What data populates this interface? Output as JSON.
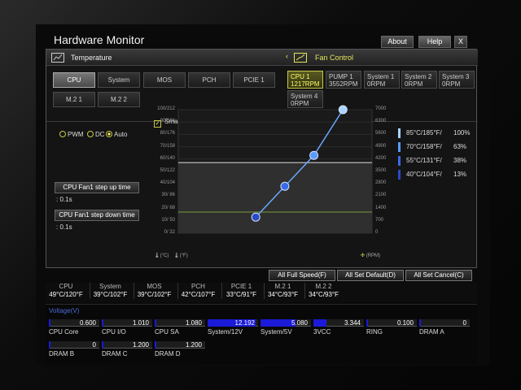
{
  "header": {
    "title": "Hardware Monitor",
    "about_label": "About",
    "help_label": "Help",
    "close_label": "X"
  },
  "temperature": {
    "title": "Temperature",
    "sensors": [
      "CPU",
      "System",
      "MOS",
      "PCH",
      "PCIE 1",
      "M.2 1",
      "M.2 2"
    ],
    "selected": "CPU"
  },
  "fan_control": {
    "title": "Fan Control",
    "fans": [
      {
        "name": "CPU 1",
        "rpm": "1217RPM"
      },
      {
        "name": "PUMP 1",
        "rpm": "3552RPM"
      },
      {
        "name": "System 1",
        "rpm": "0RPM"
      },
      {
        "name": "System 2",
        "rpm": "0RPM"
      },
      {
        "name": "System 3",
        "rpm": "0RPM"
      },
      {
        "name": "System 4",
        "rpm": "0RPM"
      }
    ]
  },
  "mode": {
    "pwm": "PWM",
    "dc": "DC",
    "auto": "Auto",
    "selected": "Auto"
  },
  "step_up": {
    "label": "CPU Fan1 step up time",
    "value": ": 0.1s"
  },
  "step_down": {
    "label": "CPU Fan1 step down time",
    "value": ": 0.1s"
  },
  "smart_fan": {
    "label": "Smart Fan Mode",
    "checked": true
  },
  "chart_data": {
    "type": "line",
    "title": "",
    "left_axis_ticks": [
      "100/212",
      "90/194",
      "80/176",
      "70/158",
      "60/140",
      "50/122",
      "40/104",
      "30/ 86",
      "20/ 68",
      "10/ 50",
      "0/ 32"
    ],
    "right_axis_ticks": [
      "7000",
      "6300",
      "5600",
      "4900",
      "4200",
      "3500",
      "2800",
      "2100",
      "1400",
      "700",
      "0"
    ],
    "xlabel_c": "(°C)",
    "xlabel_f": "(°F)",
    "ylabel": "(RPM)",
    "xlim": [
      0,
      100
    ],
    "ylim": [
      0,
      7000
    ],
    "curve": {
      "name": "Smart Fan Curve",
      "points": [
        {
          "temp": 40,
          "pct": 13
        },
        {
          "temp": 55,
          "pct": 38
        },
        {
          "temp": 70,
          "pct": 63
        },
        {
          "temp": 85,
          "pct": 100
        }
      ]
    },
    "grey_line_rpm": 4000,
    "green_line_rpm": 1200
  },
  "legend": [
    {
      "label": "85°C/185°F/",
      "pct": "100%",
      "color": "#aad4ff"
    },
    {
      "label": "70°C/158°F/",
      "pct": "63%",
      "color": "#5a9aff"
    },
    {
      "label": "55°C/131°F/",
      "pct": "38%",
      "color": "#3a6ae8"
    },
    {
      "label": "40°C/104°F/",
      "pct": "13%",
      "color": "#2a4ac8"
    }
  ],
  "actions": {
    "full_speed": "All Full Speed(F)",
    "set_default": "All Set Default(D)",
    "set_cancel": "All Set Cancel(C)"
  },
  "temps": [
    {
      "name": "CPU",
      "value": "49°C/120°F"
    },
    {
      "name": "System",
      "value": "39°C/102°F"
    },
    {
      "name": "MOS",
      "value": "39°C/102°F"
    },
    {
      "name": "PCH",
      "value": "42°C/107°F"
    },
    {
      "name": "PCIE 1",
      "value": "33°C/91°F"
    },
    {
      "name": "M.2 1",
      "value": "34°C/93°F"
    },
    {
      "name": "M.2 2",
      "value": "34°C/93°F"
    }
  ],
  "voltage": {
    "title": "Voltage(V)",
    "items": [
      {
        "name": "CPU Core",
        "value": "0.600",
        "fill": 0.03
      },
      {
        "name": "CPU I/O",
        "value": "1.010",
        "fill": 0.03
      },
      {
        "name": "CPU SA",
        "value": "1.080",
        "fill": 0.03
      },
      {
        "name": "System/12V",
        "value": "12.192",
        "fill": 0.95
      },
      {
        "name": "System/5V",
        "value": "5.080",
        "fill": 0.7
      },
      {
        "name": "3VCC",
        "value": "3.344",
        "fill": 0.25
      },
      {
        "name": "RING",
        "value": "0.100",
        "fill": 0.0
      },
      {
        "name": "DRAM A",
        "value": "0",
        "fill": 0.0
      },
      {
        "name": "DRAM B",
        "value": "0",
        "fill": 0.0
      },
      {
        "name": "DRAM C",
        "value": "1.200",
        "fill": 0.03
      },
      {
        "name": "DRAM D",
        "value": "1.200",
        "fill": 0.03
      }
    ]
  }
}
